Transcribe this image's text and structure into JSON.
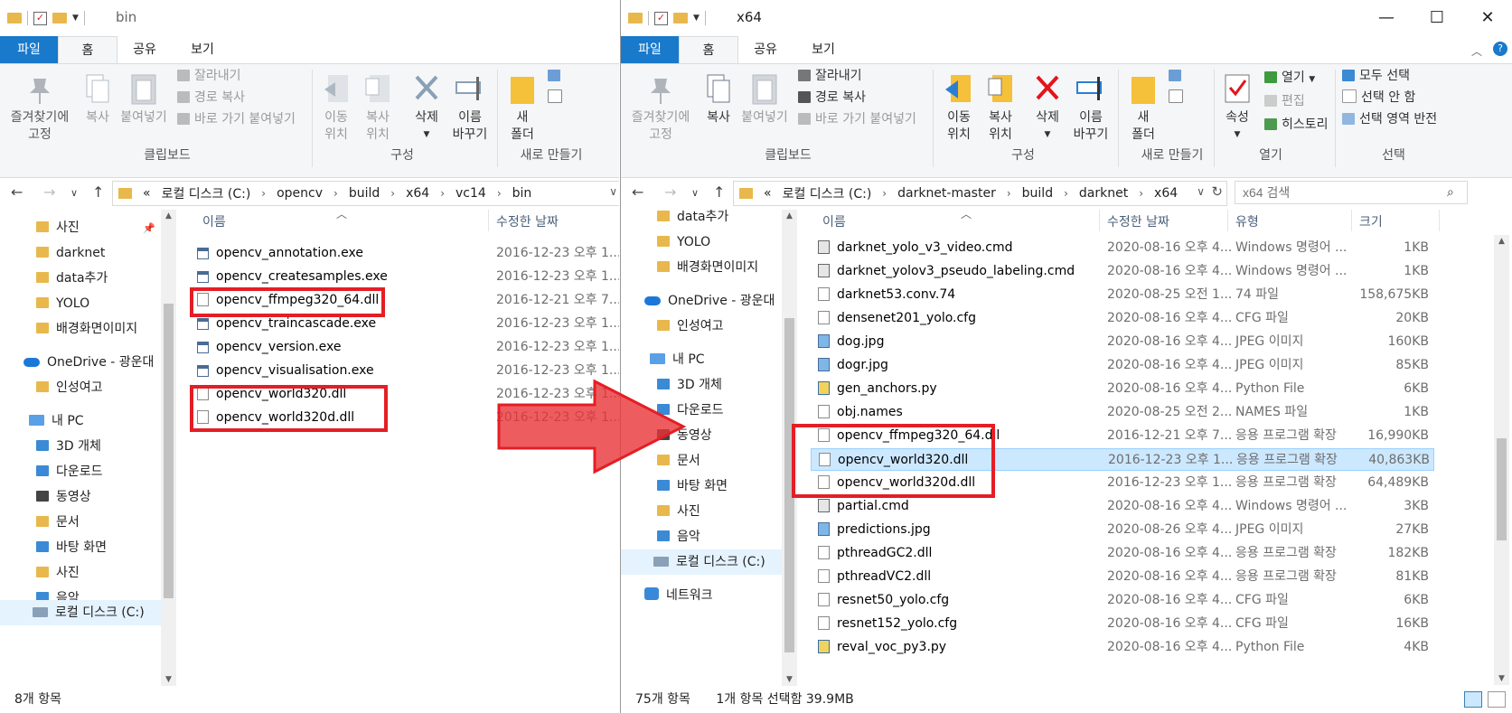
{
  "left": {
    "title": "bin",
    "tabs": [
      "파일",
      "홈",
      "공유",
      "보기"
    ],
    "ribbon": {
      "pin": "즐겨찾기에\n고정",
      "copy": "복사",
      "paste": "붙여넣기",
      "cut": "잘라내기",
      "copy_path": "경로 복사",
      "paste_shortcut": "바로 가기 붙여넣기",
      "move_to": "이동\n위치",
      "copy_to": "복사\n위치",
      "delete": "삭제",
      "rename": "이름\n바꾸기",
      "new_folder": "새\n폴더",
      "groups": [
        "클립보드",
        "구성",
        "새로 만들기"
      ]
    },
    "breadcrumbs": [
      "«",
      "로컬 디스크 (C:)",
      "opencv",
      "build",
      "x64",
      "vc14",
      "bin"
    ],
    "nav": [
      "사진",
      "darknet",
      "data추가",
      "YOLO",
      "배경화면이미지",
      "OneDrive - 광운대",
      "인성여고",
      "내 PC",
      "3D 개체",
      "다운로드",
      "동영상",
      "문서",
      "바탕 화면",
      "사진",
      "음악",
      "로컬 디스크 (C:)"
    ],
    "columns": [
      "이름",
      "수정한 날짜"
    ],
    "files": [
      {
        "name": "opencv_annotation.exe",
        "date": "2016-12-23 오후 1..."
      },
      {
        "name": "opencv_createsamples.exe",
        "date": "2016-12-23 오후 1..."
      },
      {
        "name": "opencv_ffmpeg320_64.dll",
        "date": "2016-12-21 오후 7..."
      },
      {
        "name": "opencv_traincascade.exe",
        "date": "2016-12-23 오후 1..."
      },
      {
        "name": "opencv_version.exe",
        "date": "2016-12-23 오후 1..."
      },
      {
        "name": "opencv_visualisation.exe",
        "date": "2016-12-23 오후 1..."
      },
      {
        "name": "opencv_world320.dll",
        "date": "2016-12-23 오후 1..."
      },
      {
        "name": "opencv_world320d.dll",
        "date": "2016-12-23 오후 1..."
      }
    ],
    "status": "8개 항목"
  },
  "right": {
    "title": "x64",
    "tabs": [
      "파일",
      "홈",
      "공유",
      "보기"
    ],
    "ribbon": {
      "pin": "즐겨찾기에\n고정",
      "copy": "복사",
      "paste": "붙여넣기",
      "cut": "잘라내기",
      "copy_path": "경로 복사",
      "paste_shortcut": "바로 가기 붙여넣기",
      "move_to": "이동\n위치",
      "copy_to": "복사\n위치",
      "delete": "삭제",
      "rename": "이름\n바꾸기",
      "new_folder": "새\n폴더",
      "properties": "속성",
      "open": "열기",
      "edit": "편집",
      "history": "히스토리",
      "select_all": "모두 선택",
      "select_none": "선택 안 함",
      "invert": "선택 영역 반전",
      "groups": [
        "클립보드",
        "구성",
        "새로 만들기",
        "열기",
        "선택"
      ]
    },
    "breadcrumbs": [
      "«",
      "로컬 디스크 (C:)",
      "darknet-master",
      "build",
      "darknet",
      "x64"
    ],
    "search_placeholder": "x64 검색",
    "nav": [
      "data추가",
      "YOLO",
      "배경화면이미지",
      "OneDrive - 광운대",
      "인성여고",
      "내 PC",
      "3D 개체",
      "다운로드",
      "동영상",
      "문서",
      "바탕 화면",
      "사진",
      "음악",
      "로컬 디스크 (C:)",
      "네트워크"
    ],
    "columns": [
      "이름",
      "수정한 날짜",
      "유형",
      "크기"
    ],
    "files": [
      {
        "name": "darknet_yolo_v3_video.cmd",
        "date": "2020-08-16 오후 4...",
        "type": "Windows 명령어 ...",
        "size": "1KB",
        "icon": "cmd"
      },
      {
        "name": "darknet_yolov3_pseudo_labeling.cmd",
        "date": "2020-08-16 오후 4...",
        "type": "Windows 명령어 ...",
        "size": "1KB",
        "icon": "cmd"
      },
      {
        "name": "darknet53.conv.74",
        "date": "2020-08-25 오전 1...",
        "type": "74 파일",
        "size": "158,675KB",
        "icon": "file"
      },
      {
        "name": "densenet201_yolo.cfg",
        "date": "2020-08-16 오후 4...",
        "type": "CFG 파일",
        "size": "20KB",
        "icon": "file"
      },
      {
        "name": "dog.jpg",
        "date": "2020-08-16 오후 4...",
        "type": "JPEG 이미지",
        "size": "160KB",
        "icon": "img"
      },
      {
        "name": "dogr.jpg",
        "date": "2020-08-16 오후 4...",
        "type": "JPEG 이미지",
        "size": "85KB",
        "icon": "img"
      },
      {
        "name": "gen_anchors.py",
        "date": "2020-08-16 오후 4...",
        "type": "Python File",
        "size": "6KB",
        "icon": "py"
      },
      {
        "name": "obj.names",
        "date": "2020-08-25 오전 2...",
        "type": "NAMES 파일",
        "size": "1KB",
        "icon": "file"
      },
      {
        "name": "opencv_ffmpeg320_64.dll",
        "date": "2016-12-21 오후 7...",
        "type": "응용 프로그램 확장",
        "size": "16,990KB",
        "icon": "dll"
      },
      {
        "name": "opencv_world320.dll",
        "date": "2016-12-23 오후 1...",
        "type": "응용 프로그램 확장",
        "size": "40,863KB",
        "icon": "dll"
      },
      {
        "name": "opencv_world320d.dll",
        "date": "2016-12-23 오후 1...",
        "type": "응용 프로그램 확장",
        "size": "64,489KB",
        "icon": "dll"
      },
      {
        "name": "partial.cmd",
        "date": "2020-08-16 오후 4...",
        "type": "Windows 명령어 ...",
        "size": "3KB",
        "icon": "cmd"
      },
      {
        "name": "predictions.jpg",
        "date": "2020-08-26 오후 4...",
        "type": "JPEG 이미지",
        "size": "27KB",
        "icon": "img"
      },
      {
        "name": "pthreadGC2.dll",
        "date": "2020-08-16 오후 4...",
        "type": "응용 프로그램 확장",
        "size": "182KB",
        "icon": "dll"
      },
      {
        "name": "pthreadVC2.dll",
        "date": "2020-08-16 오후 4...",
        "type": "응용 프로그램 확장",
        "size": "81KB",
        "icon": "dll"
      },
      {
        "name": "resnet50_yolo.cfg",
        "date": "2020-08-16 오후 4...",
        "type": "CFG 파일",
        "size": "6KB",
        "icon": "file"
      },
      {
        "name": "resnet152_yolo.cfg",
        "date": "2020-08-16 오후 4...",
        "type": "CFG 파일",
        "size": "16KB",
        "icon": "file"
      },
      {
        "name": "reval_voc_py3.py",
        "date": "2020-08-16 오후 4...",
        "type": "Python File",
        "size": "4KB",
        "icon": "py"
      }
    ],
    "status_count": "75개 항목",
    "status_selected": "1개 항목 선택함 39.9MB"
  },
  "colors": {
    "accent": "#1979ca",
    "highlight": "#e41e25",
    "selection": "#cce8ff"
  }
}
